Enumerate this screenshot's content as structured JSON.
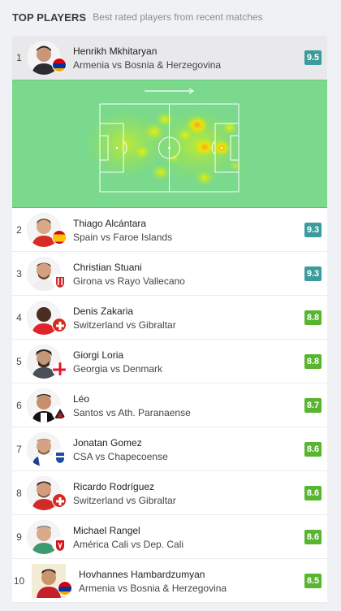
{
  "header": {
    "title": "TOP PLAYERS",
    "subtitle": "Best rated players from recent matches"
  },
  "colors": {
    "rating_teal": "#3a9c9c",
    "rating_green": "#58b52f",
    "heatmap_bg": "#7ad98c",
    "selected_row": "#e9e9ec"
  },
  "players": [
    {
      "rank": "1",
      "name": "Henrikh Mkhitaryan",
      "match": "Armenia vs Bosnia & Herzegovina",
      "rating": "9.5",
      "badge": "armenia-flag-icon"
    },
    {
      "rank": "2",
      "name": "Thiago Alcántara",
      "match": "Spain vs Faroe Islands",
      "rating": "9.3",
      "badge": "spain-flag-icon"
    },
    {
      "rank": "3",
      "name": "Christian Stuani",
      "match": "Girona vs Rayo Vallecano",
      "rating": "9.3",
      "badge": "girona-crest-icon"
    },
    {
      "rank": "4",
      "name": "Denis Zakaria",
      "match": "Switzerland vs Gibraltar",
      "rating": "8.8",
      "badge": "switzerland-flag-icon"
    },
    {
      "rank": "5",
      "name": "Giorgi Loria",
      "match": "Georgia vs Denmark",
      "rating": "8.8",
      "badge": "georgia-flag-icon"
    },
    {
      "rank": "6",
      "name": "Léo",
      "match": "Santos vs Ath. Paranaense",
      "rating": "8.7",
      "badge": "paranaense-crest-icon"
    },
    {
      "rank": "7",
      "name": "Jonatan Gomez",
      "match": "CSA vs Chapecoense",
      "rating": "8.6",
      "badge": "csa-crest-icon"
    },
    {
      "rank": "8",
      "name": "Ricardo Rodríguez",
      "match": "Switzerland vs Gibraltar",
      "rating": "8.6",
      "badge": "switzerland-flag-icon"
    },
    {
      "rank": "9",
      "name": "Michael Rangel",
      "match": "América Cali vs Dep. Cali",
      "rating": "8.6",
      "badge": "america-cali-crest-icon"
    },
    {
      "rank": "10",
      "name": "Hovhannes Hambardzumyan",
      "match": "Armenia vs Bosnia & Herzegovina",
      "rating": "8.5",
      "badge": "armenia-flag-icon"
    }
  ]
}
